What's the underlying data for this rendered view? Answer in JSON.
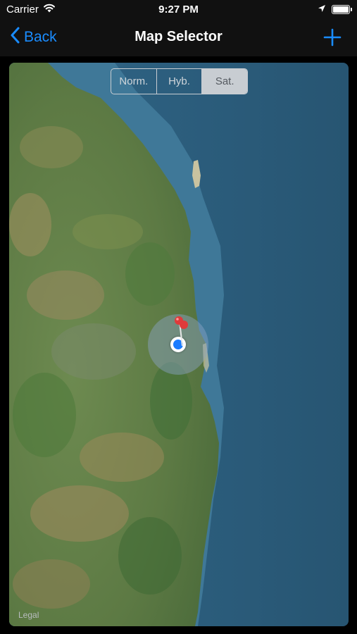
{
  "status_bar": {
    "carrier": "Carrier",
    "time": "9:27 PM"
  },
  "nav": {
    "back_label": "Back",
    "title": "Map Selector"
  },
  "map": {
    "segments": [
      "Norm.",
      "Hyb.",
      "Sat."
    ],
    "selected_segment": "Sat.",
    "legal": "Legal"
  },
  "colors": {
    "accent": "#1a8cff",
    "pin": "#e03a3a",
    "location": "#1a7cff"
  }
}
